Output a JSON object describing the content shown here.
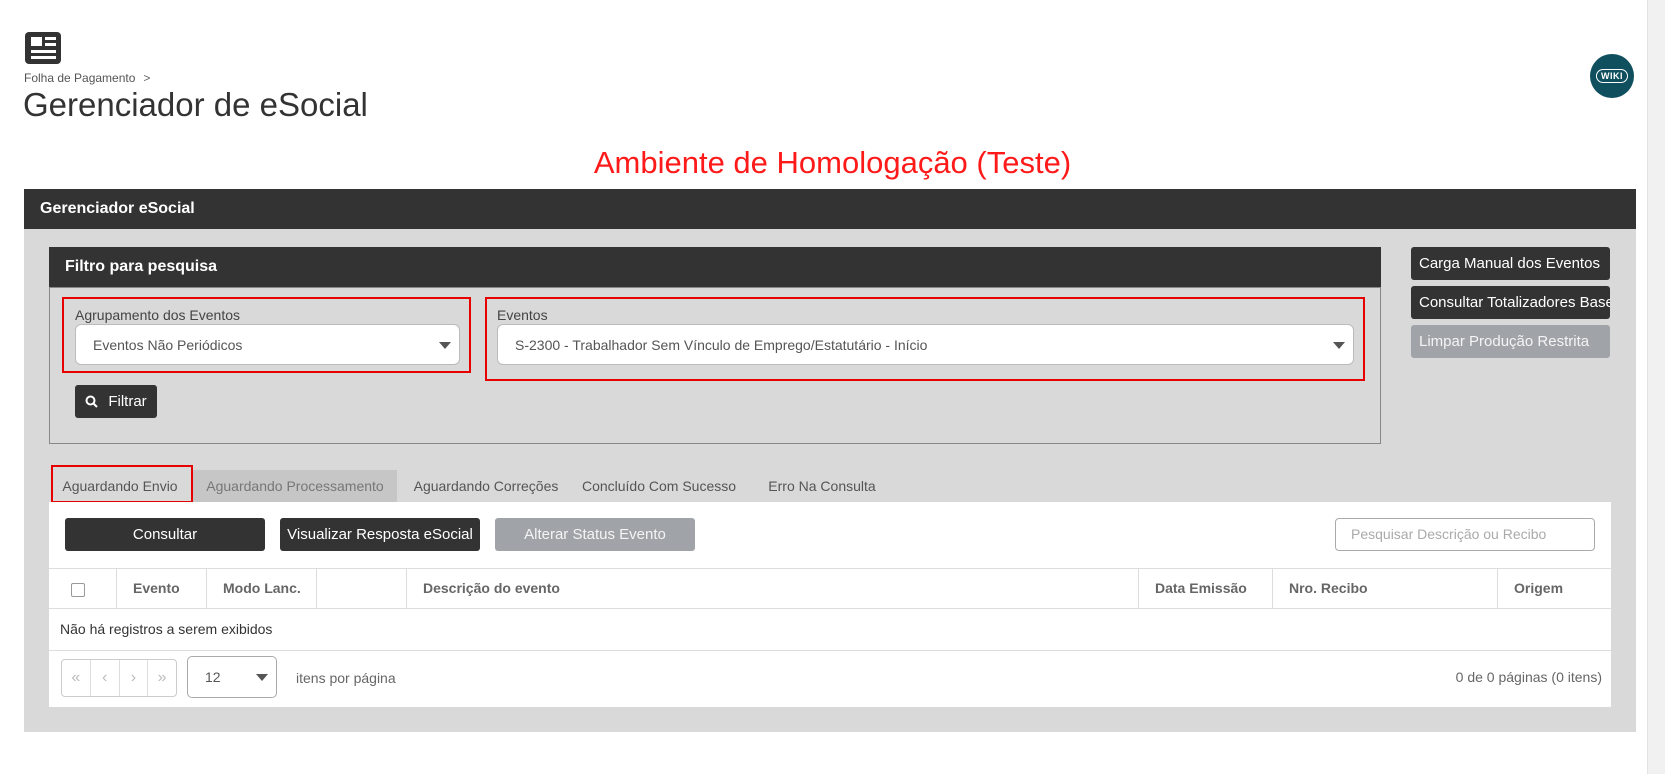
{
  "header": {
    "breadcrumb": "Folha de Pagamento",
    "breadcrumb_sep": ">",
    "title": "Gerenciador de eSocial",
    "wiki_label": "WIKI",
    "icon": "newspaper-icon"
  },
  "environment_notice": "Ambiente de Homologação (Teste)",
  "panel": {
    "title": "Gerenciador eSocial",
    "filter": {
      "title": "Filtro para pesquisa",
      "grouping_label": "Agrupamento dos Eventos",
      "grouping_value": "Eventos Não Periódicos",
      "events_label": "Eventos",
      "events_value": "S-2300 - Trabalhador Sem Vínculo de Emprego/Estatutário - Início",
      "filter_button": "Filtrar"
    },
    "side_buttons": [
      "Carga Manual dos Eventos",
      "Consultar Totalizadores Base",
      "Limpar Produção Restrita"
    ],
    "tabs": [
      "Aguardando Envio",
      "Aguardando Processamento",
      "Aguardando Correções",
      "Concluído Com Sucesso",
      "Erro Na Consulta"
    ],
    "actions": {
      "consult": "Consultar",
      "view_response": "Visualizar Resposta eSocial",
      "change_status": "Alterar Status Evento",
      "search_placeholder": "Pesquisar Descrição ou Recibo"
    },
    "table": {
      "columns": [
        "Evento",
        "Modo Lanc.",
        "",
        "Descrição do evento",
        "Data Emissão",
        "Nro. Recibo",
        "Origem"
      ],
      "empty_message": "Não há registros a serem exibidos"
    },
    "pager": {
      "first": "«",
      "prev": "‹",
      "next": "›",
      "last": "»",
      "page_size": "12",
      "per_page_label": "itens por página",
      "summary": "0 de 0 páginas (0 itens)"
    }
  },
  "colors": {
    "dark": "#333333",
    "accent_red": "#e60000",
    "wiki_bg": "#0f4f5e"
  }
}
